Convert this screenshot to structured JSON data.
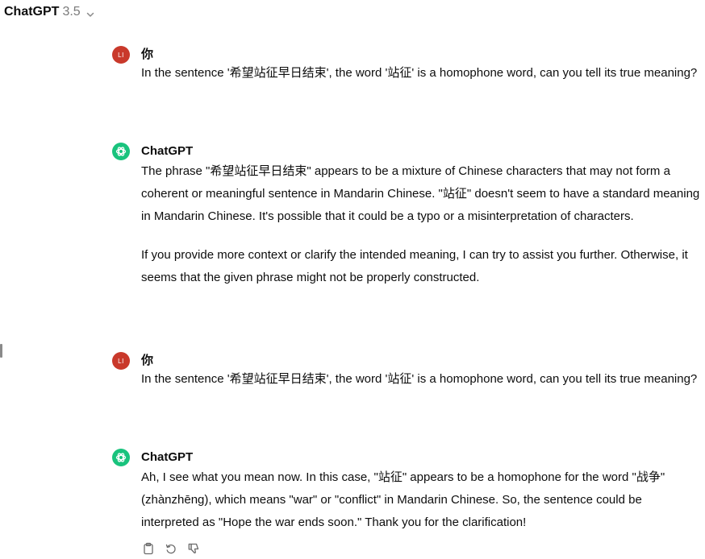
{
  "header": {
    "model_name": "ChatGPT",
    "model_version": "3.5"
  },
  "messages": [
    {
      "role": "user",
      "avatar_initials": "LI",
      "author": "你",
      "paragraphs": [
        "In the sentence '希望站征早日结束', the word '站征' is a homophone word, can you tell its true meaning?"
      ]
    },
    {
      "role": "assistant",
      "author": "ChatGPT",
      "paragraphs": [
        "The phrase \"希望站征早日结束\" appears to be a mixture of Chinese characters that may not form a coherent or meaningful sentence in Mandarin Chinese. \"站征\" doesn't seem to have a standard meaning in Mandarin Chinese. It's possible that it could be a typo or a misinterpretation of characters.",
        "If you provide more context or clarify the intended meaning, I can try to assist you further. Otherwise, it seems that the given phrase might not be properly constructed."
      ]
    },
    {
      "role": "user",
      "avatar_initials": "LI",
      "author": "你",
      "paragraphs": [
        "In the sentence '希望站征早日结束', the word '站征' is a homophone word, can you tell its true meaning?"
      ]
    },
    {
      "role": "assistant",
      "author": "ChatGPT",
      "paragraphs": [
        "Ah, I see what you mean now. In this case, \"站征\" appears to be a homophone for the word \"战争\" (zhànzhēng), which means \"war\" or \"conflict\" in Mandarin Chinese. So, the sentence could be interpreted as \"Hope the war ends soon.\" Thank you for the clarification!"
      ]
    }
  ],
  "actions": {
    "icons": [
      "clipboard-icon",
      "regenerate-icon",
      "thumbs-down-icon"
    ]
  },
  "colors": {
    "user_avatar": "#c9392b",
    "assistant_avatar": "#19c37d",
    "version_text": "#7a7a7a"
  }
}
